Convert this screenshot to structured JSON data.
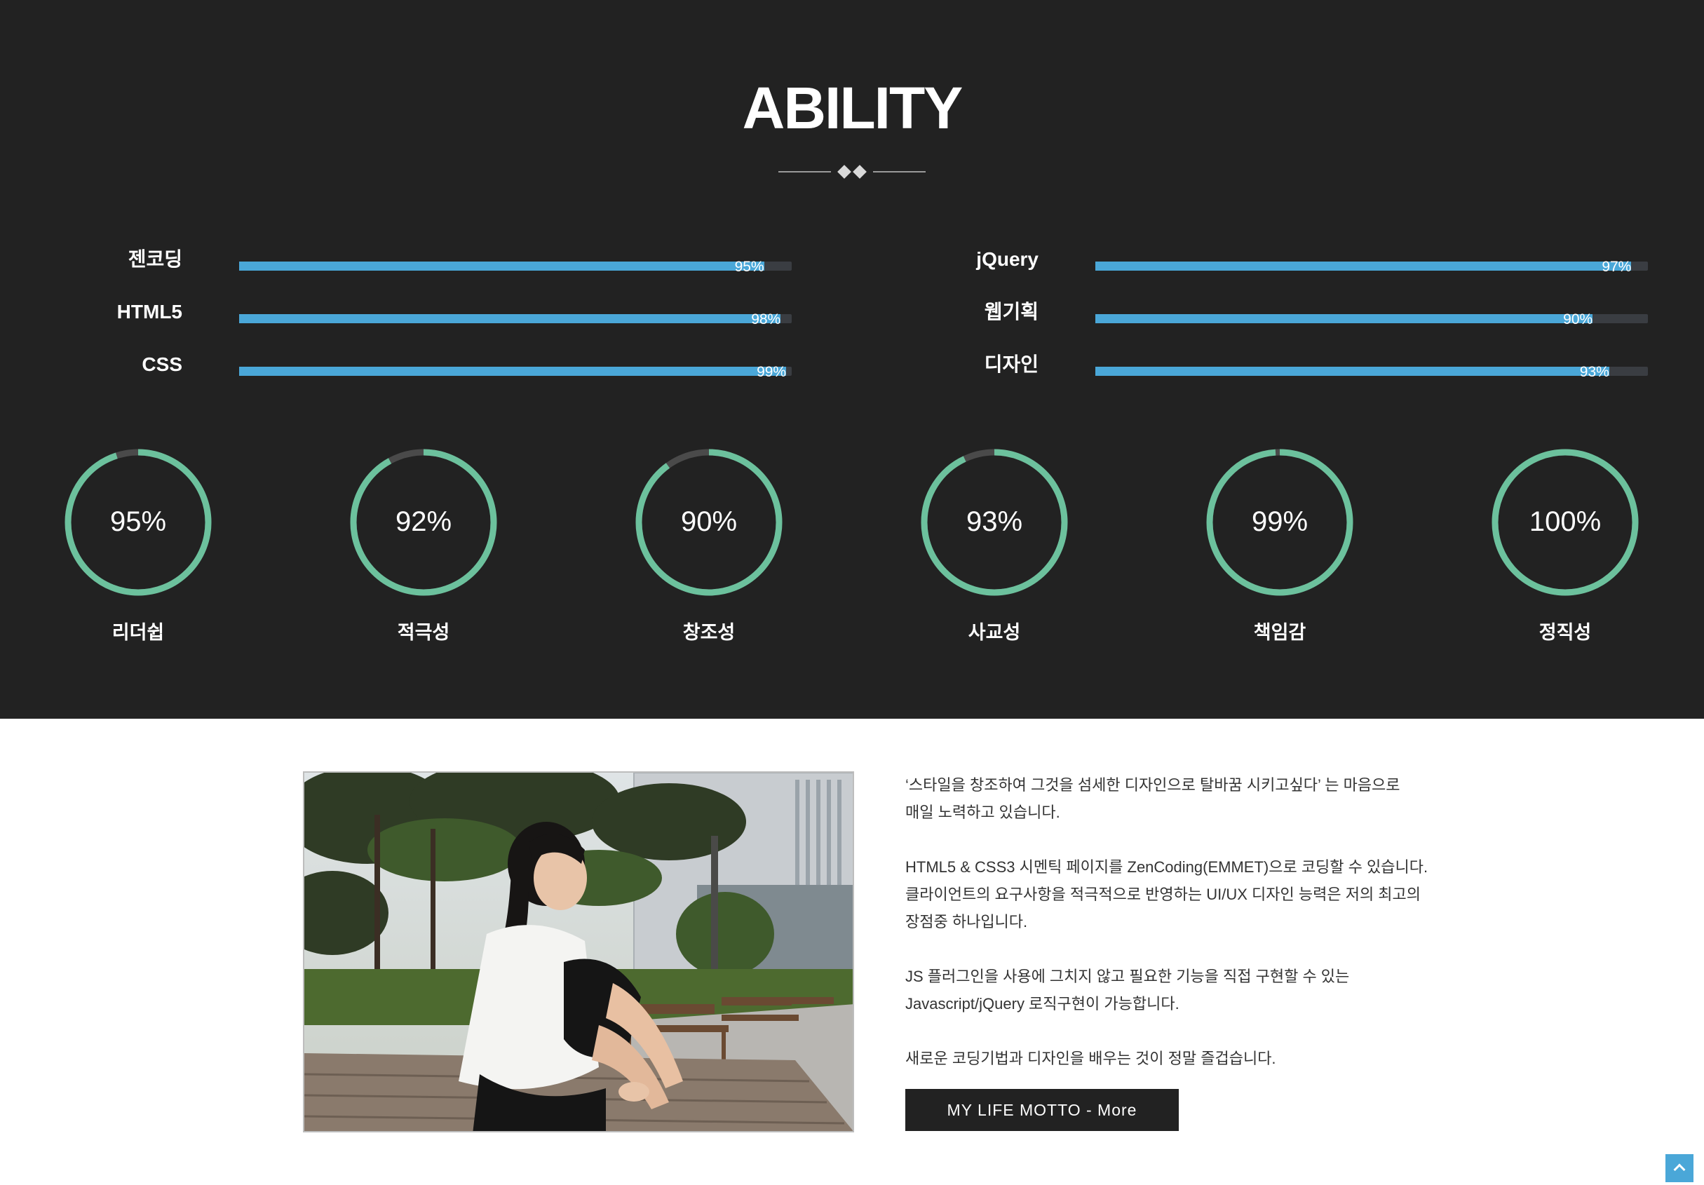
{
  "ability": {
    "title": "ABILITY",
    "skills_left": [
      {
        "name": "젠코딩",
        "percent_label": "95%",
        "value": 0.95
      },
      {
        "name": "HTML5",
        "percent_label": "98%",
        "value": 0.98
      },
      {
        "name": "CSS",
        "percent_label": "99%",
        "value": 0.99
      }
    ],
    "skills_right": [
      {
        "name": "jQuery",
        "percent_label": "97%",
        "value": 0.97
      },
      {
        "name": "웹기획",
        "percent_label": "90%",
        "value": 0.9
      },
      {
        "name": "디자인",
        "percent_label": "93%",
        "value": 0.93
      }
    ],
    "circles": [
      {
        "value_label": "95%",
        "value": 0.95,
        "label": "리더쉽"
      },
      {
        "value_label": "92%",
        "value": 0.92,
        "label": "적극성"
      },
      {
        "value_label": "90%",
        "value": 0.9,
        "label": "창조성"
      },
      {
        "value_label": "93%",
        "value": 0.93,
        "label": "사교성"
      },
      {
        "value_label": "99%",
        "value": 0.99,
        "label": "책임감"
      },
      {
        "value_label": "100%",
        "value": 1.0,
        "label": "정직성"
      }
    ]
  },
  "colors": {
    "section_bg": "#222222",
    "bar_fill": "#4aa7d8",
    "bar_track": "#3a3d42",
    "ring": "#6cc19d",
    "ring_track": "#4a4a4a",
    "button_bg": "#222222",
    "top_button": "#4aa7d8"
  },
  "about": {
    "paragraphs": [
      [
        "‘스타일을 창조하여 그것을 섬세한 디자인으로 탈바꿈 시키고싶다’ 는 마음으로",
        "매일 노력하고 있습니다."
      ],
      [
        "HTML5 & CSS3 시멘틱 페이지를 ZenCoding(EMMET)으로 코딩할 수 있습니다.",
        "클라이언트의 요구사항을 적극적으로 반영하는 UI/UX 디자인 능력은 저의 최고의",
        "장점중 하나입니다."
      ],
      [
        "JS 플러그인을 사용에 그치지 않고 필요한 기능을 직접 구현할 수 있는",
        "Javascript/jQuery 로직구현이 가능합니다."
      ],
      [
        "새로운 코딩기법과 디자인을 배우는 것이 정말 즐겁습니다."
      ]
    ],
    "button_label": "MY LIFE MOTTO - More"
  },
  "icons": {
    "divider": "diamond-divider-icon",
    "top": "chevron-up-icon"
  }
}
